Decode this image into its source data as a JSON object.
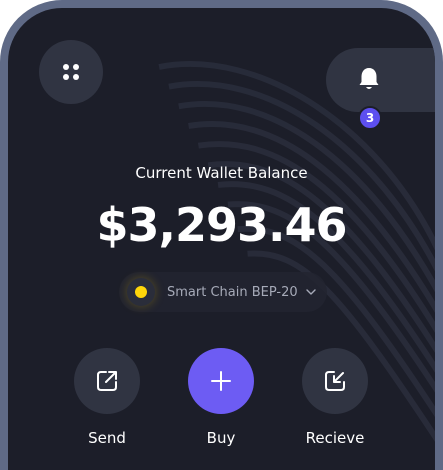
{
  "header": {
    "menu_icon": "grid-dots-icon",
    "notification_icon": "bell-icon",
    "notification_count": "3"
  },
  "wallet": {
    "label": "Current Wallet Balance",
    "balance": "$3,293.46"
  },
  "network": {
    "name": "Smart Chain BEP-20",
    "status_color": "#ffd60a",
    "chevron_icon": "chevron-down-icon"
  },
  "actions": [
    {
      "label": "Send",
      "icon": "send-arrow-icon"
    },
    {
      "label": "Buy",
      "icon": "plus-icon"
    },
    {
      "label": "Recieve",
      "icon": "receive-arrow-icon"
    }
  ],
  "colors": {
    "frame": "#5f6a86",
    "background": "#1c1e29",
    "surface": "#303442",
    "accent": "#6d5cf3"
  }
}
